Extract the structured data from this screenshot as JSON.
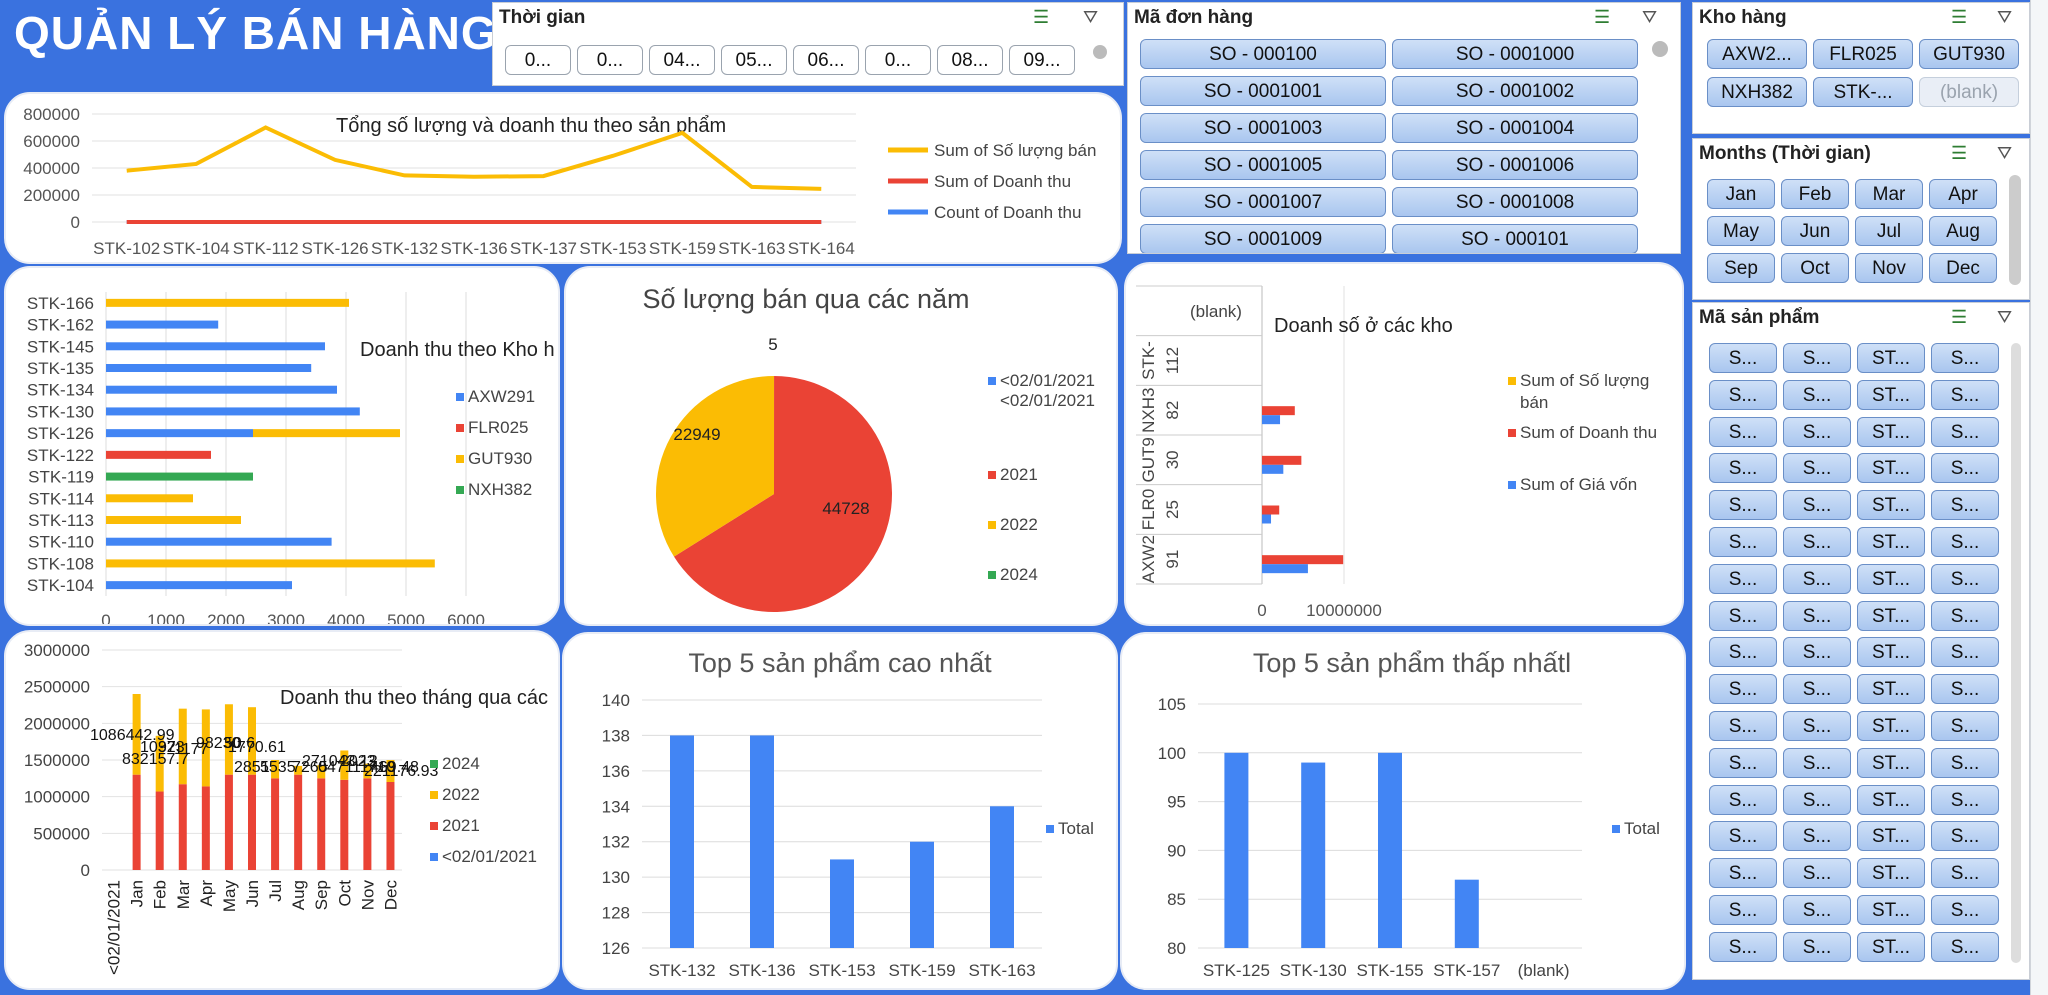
{
  "header": {
    "title": "QUẢN LÝ BÁN HÀNG"
  },
  "slicer_time": {
    "title": "Thời gian",
    "items": [
      "0...",
      "0...",
      "04...",
      "05...",
      "06...",
      "0...",
      "08...",
      "09..."
    ]
  },
  "slicer_order": {
    "title": "Mã đơn hàng",
    "items": [
      "SO - 000100",
      "SO - 0001000",
      "SO - 0001001",
      "SO - 0001002",
      "SO - 0001003",
      "SO - 0001004",
      "SO - 0001005",
      "SO - 0001006",
      "SO - 0001007",
      "SO - 0001008",
      "SO - 0001009",
      "SO - 000101"
    ]
  },
  "slicer_warehouse": {
    "title": "Kho hàng",
    "items": [
      "AXW2...",
      "FLR025",
      "GUT930",
      "NXH382",
      "STK-...",
      "(blank)"
    ]
  },
  "slicer_months": {
    "title": "Months (Thời gian)",
    "items": [
      "Jan",
      "Feb",
      "Mar",
      "Apr",
      "May",
      "Jun",
      "Jul",
      "Aug",
      "Sep",
      "Oct",
      "Nov",
      "Dec"
    ]
  },
  "slicer_product": {
    "title": "Mã sản phẩm",
    "cols": [
      "S...",
      "S...",
      "ST...",
      "S..."
    ],
    "rows": 17
  },
  "colors": {
    "blue": "#4285f4",
    "red": "#ea4335",
    "yellow": "#fbbc04",
    "green": "#34a853",
    "bg": "#3a72df"
  },
  "chart_data": [
    {
      "id": "line",
      "type": "line",
      "title": "Tổng số lượng và doanh thu theo sản phẩm",
      "categories": [
        "STK-102",
        "STK-104",
        "STK-112",
        "STK-126",
        "STK-132",
        "STK-136",
        "STK-137",
        "STK-153",
        "STK-159",
        "STK-163",
        "STK-164"
      ],
      "yticks": [
        "800000",
        "600000",
        "400000",
        "200000",
        "0"
      ],
      "ylim": [
        0,
        800000
      ],
      "series": [
        {
          "name": "Sum of Số lượng bán",
          "color": "#fbbc04",
          "values": [
            380000,
            430000,
            700000,
            460000,
            345000,
            335000,
            340000,
            490000,
            660000,
            260000,
            245000
          ]
        },
        {
          "name": "Sum of Doanh thu",
          "color": "#ea4335",
          "values": [
            0,
            0,
            0,
            0,
            0,
            0,
            0,
            0,
            0,
            0,
            0
          ]
        },
        {
          "name": "Count of Doanh thu",
          "color": "#4285f4",
          "values": [
            0,
            0,
            0,
            0,
            0,
            0,
            0,
            0,
            0,
            0,
            0
          ]
        }
      ]
    },
    {
      "id": "hbar",
      "type": "bar",
      "title": "Doanh thu theo Kho h",
      "categories": [
        "STK-166",
        "STK-162",
        "STK-145",
        "STK-135",
        "STK-134",
        "STK-130",
        "STK-126",
        "STK-122",
        "STK-119",
        "STK-114",
        "STK-113",
        "STK-110",
        "STK-108",
        "STK-104"
      ],
      "xticks": [
        "0",
        "1000",
        "2000",
        "3000",
        "4000",
        "5000",
        "6000"
      ],
      "xlim": [
        0,
        6000
      ],
      "legend": [
        {
          "name": "AXW291",
          "color": "#4285f4"
        },
        {
          "name": "FLR025",
          "color": "#ea4335"
        },
        {
          "name": "GUT930",
          "color": "#fbbc04"
        },
        {
          "name": "NXH382",
          "color": "#34a853"
        }
      ],
      "bars": [
        [
          {
            "s": "GUT930",
            "v": 4050
          }
        ],
        [
          {
            "s": "AXW291",
            "v": 1870
          }
        ],
        [
          {
            "s": "AXW291",
            "v": 3650
          }
        ],
        [
          {
            "s": "AXW291",
            "v": 3420
          }
        ],
        [
          {
            "s": "AXW291",
            "v": 3850
          }
        ],
        [
          {
            "s": "AXW291",
            "v": 4230
          }
        ],
        [
          {
            "s": "AXW291",
            "v": 2450
          },
          {
            "s": "GUT930",
            "v": 2450
          }
        ],
        [
          {
            "s": "FLR025",
            "v": 1750
          }
        ],
        [
          {
            "s": "NXH382",
            "v": 2450
          }
        ],
        [
          {
            "s": "GUT930",
            "v": 1450
          }
        ],
        [
          {
            "s": "GUT930",
            "v": 2250
          }
        ],
        [
          {
            "s": "AXW291",
            "v": 3760
          }
        ],
        [
          {
            "s": "GUT930",
            "v": 5480
          }
        ],
        [
          {
            "s": "AXW291",
            "v": 3100
          }
        ]
      ]
    },
    {
      "id": "pie",
      "type": "pie",
      "title": "Số lượng bán qua các năm",
      "slices": [
        {
          "name": "<02/01/2021 <02/01/2021",
          "value": 5,
          "color": "#4285f4"
        },
        {
          "name": "2021",
          "value": 44728,
          "color": "#ea4335"
        },
        {
          "name": "2022",
          "value": 22949,
          "color": "#fbbc04"
        },
        {
          "name": "2024",
          "value": 0,
          "color": "#34a853"
        }
      ],
      "labels": [
        "5",
        "44728",
        "22949"
      ]
    },
    {
      "id": "whbar",
      "type": "bar",
      "title": "Doanh số ở các kho",
      "categories": [
        "(blank)",
        "STK- 112",
        "NXH3 82",
        "GUT9 30",
        "FLR0 25",
        "AXW2 91"
      ],
      "xticks": [
        "0",
        "10000000"
      ],
      "xlim": [
        0,
        20000000
      ],
      "legend": [
        {
          "name": "Sum of Số lượng bán",
          "color": "#fbbc04"
        },
        {
          "name": "Sum of Doanh thu",
          "color": "#ea4335"
        },
        {
          "name": "Sum of Giá vốn",
          "color": "#4285f4"
        }
      ],
      "groups": [
        {
          "yellow": 0,
          "red": 0,
          "blue": 0
        },
        {
          "yellow": 0,
          "red": 0,
          "blue": 0
        },
        {
          "yellow": 0,
          "red": 4000000,
          "blue": 2200000
        },
        {
          "yellow": 0,
          "red": 4800000,
          "blue": 2600000
        },
        {
          "yellow": 0,
          "red": 2100000,
          "blue": 1100000
        },
        {
          "yellow": 0,
          "red": 9900000,
          "blue": 5600000
        }
      ]
    },
    {
      "id": "monthly",
      "type": "bar",
      "title": "Doanh thu theo tháng qua các",
      "categories": [
        "<02/01/2021",
        "Jan",
        "Feb",
        "Mar",
        "Apr",
        "May",
        "Jun",
        "Jul",
        "Aug",
        "Sep",
        "Oct",
        "Nov",
        "Dec"
      ],
      "yticks": [
        "3000000",
        "2500000",
        "2000000",
        "1500000",
        "1000000",
        "500000",
        "0"
      ],
      "ylim": [
        0,
        3000000
      ],
      "legend": [
        {
          "name": "2024",
          "color": "#34a853"
        },
        {
          "name": "2022",
          "color": "#fbbc04"
        },
        {
          "name": "2021",
          "color": "#ea4335"
        },
        {
          "name": "<02/01/2021",
          "color": "#4285f4"
        }
      ],
      "stacks": [
        {
          "red": 0,
          "yellow": 0
        },
        {
          "red": 1300000,
          "yellow": 1100000
        },
        {
          "red": 1070000,
          "yellow": 760000
        },
        {
          "red": 1170000,
          "yellow": 1030000
        },
        {
          "red": 1140000,
          "yellow": 1050000
        },
        {
          "red": 1300000,
          "yellow": 960000
        },
        {
          "red": 1300000,
          "yellow": 920000
        },
        {
          "red": 1250000,
          "yellow": 250000
        },
        {
          "red": 1300000,
          "yellow": 120000
        },
        {
          "red": 1250000,
          "yellow": 180000
        },
        {
          "red": 1230000,
          "yellow": 400000
        },
        {
          "red": 1250000,
          "yellow": 200000
        },
        {
          "red": 1200000,
          "yellow": 300000
        }
      ],
      "data_labels": [
        "1086442.99",
        "832157.7",
        "1032",
        "973",
        "98230",
        "1177",
        "50.6",
        "1770.61",
        "2851",
        "5535",
        "7265",
        "0471",
        "11710",
        "271043.12",
        "2023",
        "469.48",
        "221176.93"
      ]
    },
    {
      "id": "top5high",
      "type": "bar",
      "title": "Top 5 sản phẩm cao nhất",
      "categories": [
        "STK-132",
        "STK-136",
        "STK-153",
        "STK-159",
        "STK-163"
      ],
      "values": [
        138,
        138,
        131,
        132,
        134
      ],
      "yticks": [
        "140",
        "138",
        "136",
        "134",
        "132",
        "130",
        "128",
        "126"
      ],
      "ylim": [
        126,
        140
      ],
      "legend": "Total"
    },
    {
      "id": "top5low",
      "type": "bar",
      "title": "Top 5 sản phẩm thấp nhấtl",
      "categories": [
        "STK-125",
        "STK-130",
        "STK-155",
        "STK-157",
        "(blank)"
      ],
      "values": [
        100,
        99,
        100,
        87,
        0
      ],
      "yticks": [
        "105",
        "100",
        "95",
        "90",
        "85",
        "80"
      ],
      "ylim": [
        80,
        105
      ],
      "legend": "Total"
    }
  ]
}
